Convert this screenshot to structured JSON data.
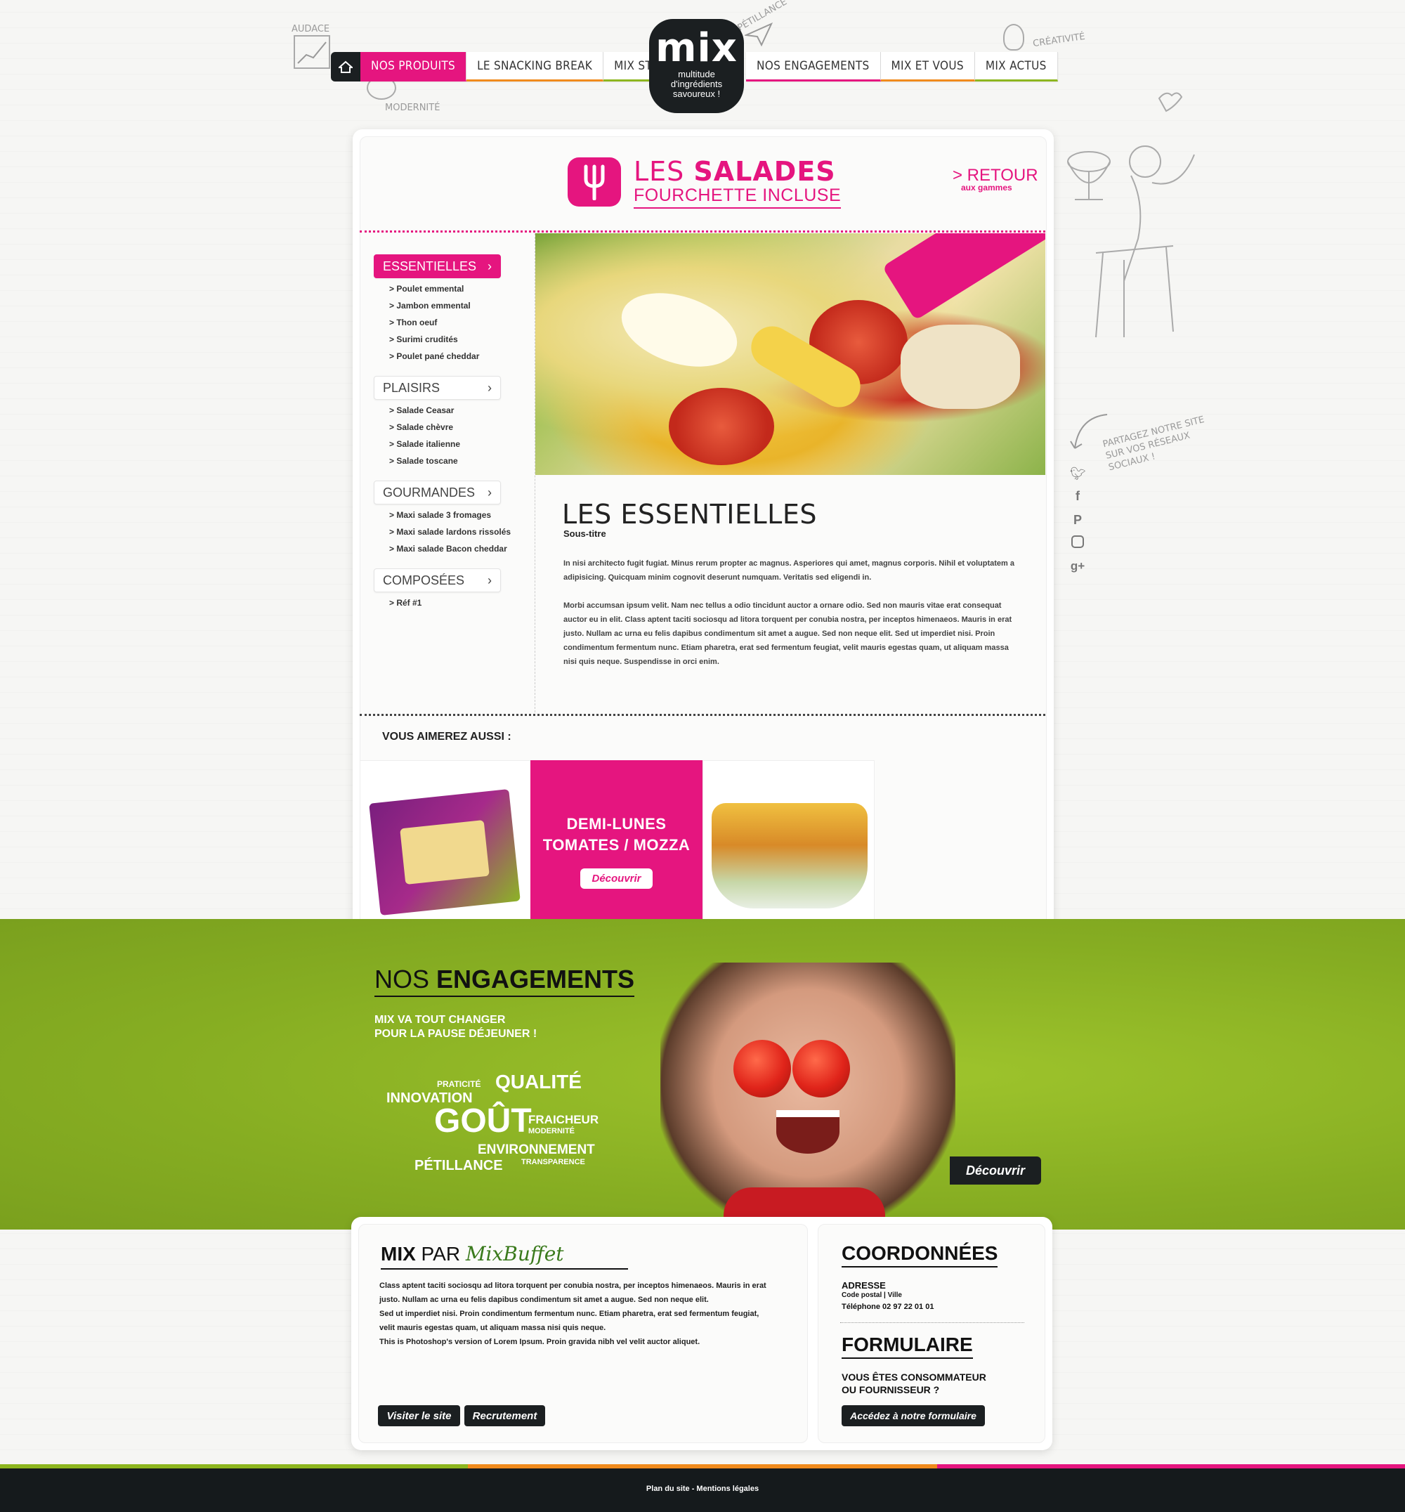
{
  "nav": {
    "left": [
      "NOS PRODUITS",
      "LE SNACKING BREAK",
      "MIX STORY"
    ],
    "right": [
      "NOS ENGAGEMENTS",
      "MIX ET VOUS",
      "MIX ACTUS"
    ]
  },
  "logo": {
    "mark": "mix",
    "sub1": "multitude",
    "sub2": "d'ingrédients",
    "sub3": "savoureux !"
  },
  "doodles": {
    "audace": "AUDACE",
    "modernite": "MODERNITÉ",
    "petillance": "PÉTILLANCE",
    "creativite": "CRÉATIVITÉ",
    "share": "PARTAGEZ NOTRE SITE SUR VOS RÉSEAUX SOCIAUX !"
  },
  "header": {
    "title_light": "LES ",
    "title_bold": "SALADES",
    "subtitle": "FOURCHETTE INCLUSE",
    "retour": "> RETOUR",
    "retour_sub": "aux gammes"
  },
  "sidebar": {
    "categories": [
      {
        "label": "ESSENTIELLES",
        "items": [
          "> Poulet emmental",
          "> Jambon emmental",
          "> Thon oeuf",
          "> Surimi crudités",
          "> Poulet pané cheddar"
        ]
      },
      {
        "label": "PLAISIRS",
        "items": [
          "> Salade Ceasar",
          "> Salade chèvre",
          "> Salade italienne",
          "> Salade toscane"
        ]
      },
      {
        "label": "GOURMANDES",
        "items": [
          "> Maxi salade 3 fromages",
          "> Maxi salade lardons rissolés",
          "> Maxi salade Bacon cheddar"
        ]
      },
      {
        "label": "COMPOSÉES",
        "items": [
          "> Réf #1"
        ]
      }
    ]
  },
  "content": {
    "title": "LES ESSENTIELLES",
    "subtitle": "Sous-titre",
    "para1": "In nisi architecto fugit fugiat. Minus rerum propter ac magnus. Asperiores qui amet, magnus corporis. Nihil et voluptatem a adipisicing. Quicquam minim cognovit deserunt numquam. Veritatis sed eligendi in.",
    "para2": "Morbi accumsan ipsum velit. Nam nec tellus a odio tincidunt auctor a ornare odio. Sed non  mauris vitae erat consequat auctor eu in elit. Class aptent taciti sociosqu ad litora torquent per conubia nostra, per inceptos himenaeos. Mauris in erat justo. Nullam ac urna eu felis dapibus condimentum sit amet a augue. Sed non neque elit. Sed ut imperdiet nisi. Proin condimentum fermentum nunc. Etiam pharetra, erat sed fermentum feugiat, velit mauris egestas quam, ut aliquam massa nisi quis neque. Suspendisse in orci enim."
  },
  "related": {
    "heading": "VOUS AIMEREZ AUSSI :",
    "promo_line1": "DEMI-LUNES",
    "promo_line2": "TOMATES / MOZZA",
    "promo_button": "Découvrir"
  },
  "engagements": {
    "title_light": "NOS ",
    "title_bold": "ENGAGEMENTS",
    "lead1": "MIX VA TOUT CHANGER",
    "lead2": "POUR LA PAUSE DÉJEUNER !",
    "words": [
      "PRATICITÉ",
      "QUALITÉ",
      "INNOVATION",
      "GOÛT",
      "FRAICHEUR",
      "MODERNITÉ",
      "ENVIRONNEMENT",
      "TRANSPARENCE",
      "PÉTILLANCE"
    ],
    "button": "Découvrir"
  },
  "footer": {
    "mix": "MIX",
    "par": " PAR ",
    "brand": "MixBuffet",
    "text": [
      "Class aptent taciti sociosqu ad litora torquent per conubia nostra, per inceptos himenaeos. Mauris in erat",
      "justo. Nullam ac urna eu felis dapibus condimentum sit amet a augue. Sed non neque elit.",
      "Sed ut imperdiet nisi. Proin condimentum fermentum nunc. Etiam pharetra, erat sed fermentum feugiat,",
      "velit mauris egestas quam, ut aliquam massa nisi quis neque.",
      "This is Photoshop's version  of Lorem Ipsum. Proin gravida nibh vel velit auctor aliquet."
    ],
    "btn_site": "Visiter le site",
    "btn_recrut": "Recrutement",
    "coord_title": "COORDONNÉES",
    "adresse": "ADRESSE",
    "cp": "Code postal  |  Ville",
    "tel": "Téléphone 02 97 22 01 01",
    "form_title": "FORMULAIRE",
    "form_q1": "VOUS ÊTES CONSOMMATEUR",
    "form_q2": "OU FOURNISSEUR ?",
    "form_btn": "Accédez à notre formulaire"
  },
  "bottom": {
    "links": "Plan du site - Mentions légales"
  },
  "colors": {
    "pink": "#e5157f",
    "green": "#8db61f",
    "orange": "#f08a1c",
    "dark": "#1b1f21"
  }
}
